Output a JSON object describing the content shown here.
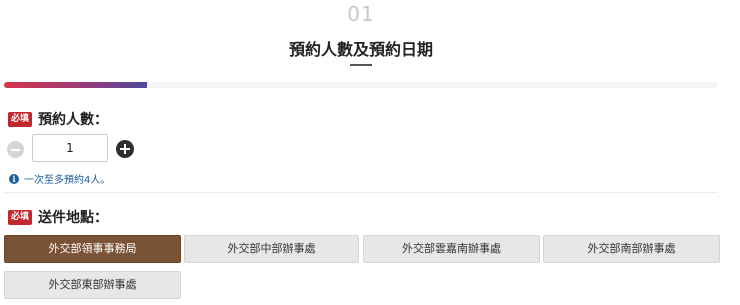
{
  "step": {
    "number": "01",
    "title": "預約人數及預約日期"
  },
  "progress": {
    "value_percent": 20
  },
  "party_size": {
    "required_badge": "必填",
    "label": "預約人數：",
    "value": "1",
    "note": "一次至多預約4人。"
  },
  "delivery_location": {
    "required_badge": "必填",
    "label": "送件地點：",
    "options": [
      {
        "label": "外交部領事事務局",
        "selected": true
      },
      {
        "label": "外交部中部辦事處",
        "selected": false
      },
      {
        "label": "外交部雲嘉南辦事處",
        "selected": false
      },
      {
        "label": "外交部南部辦事處",
        "selected": false
      },
      {
        "label": "外交部東部辦事處",
        "selected": false
      }
    ]
  },
  "colors": {
    "required_badge": "#c0282e",
    "selected_option": "#7a5235",
    "info_text": "#1e5f9e"
  },
  "icons": {
    "minus": "minus-circle-icon",
    "plus": "plus-circle-icon",
    "info": "info-circle-icon"
  }
}
